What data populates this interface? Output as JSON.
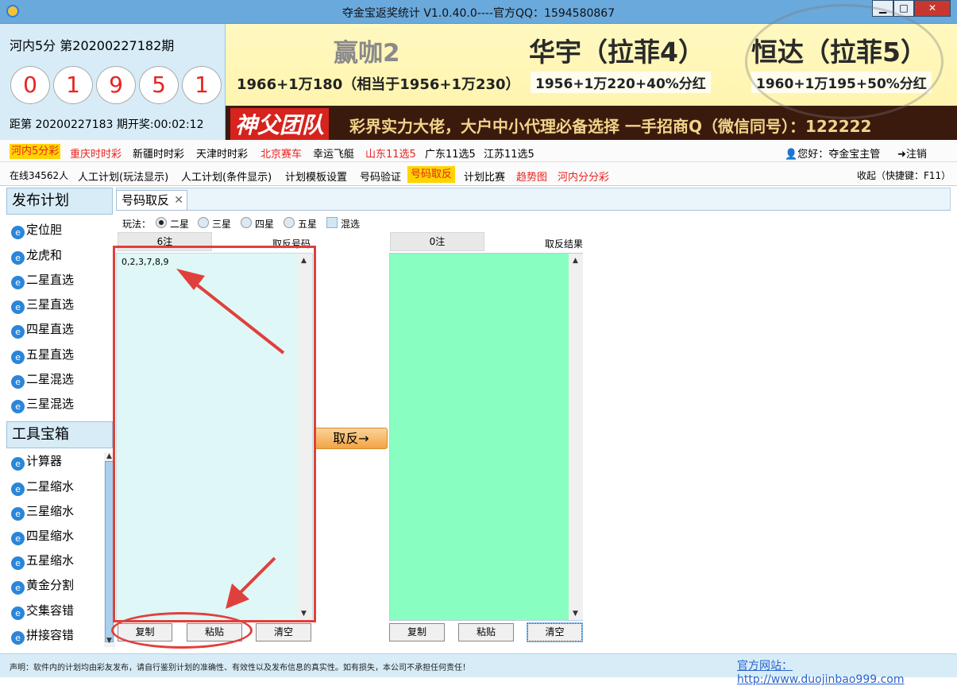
{
  "window": {
    "title": "夺金宝返奖统计  V1.0.40.0----官方QQ：1594580867",
    "min_glyph": "▁",
    "max_glyph": "□",
    "close_glyph": "✕",
    "app_icon": "app-logo-icon"
  },
  "lottery": {
    "name": "河内5分  第20200227182期",
    "balls": [
      "0",
      "1",
      "9",
      "5",
      "1"
    ],
    "next_draw": "距第 20200227183 期开奖:00:02:12"
  },
  "banner": {
    "line1_a": "赢咖2",
    "line1_b": "华宇（拉菲4）",
    "line1_c": "恒达（拉菲5）",
    "line2_a": "1966+1万180（相当于1956+1万230）",
    "line2_b": "1956+1万220+40%分红",
    "line2_c": "1960+1万195+50%分红",
    "team": "神父团队",
    "slogan": "彩界实力大佬，大户中小代理必备选择 一手招商Q（微信同号）：122222"
  },
  "menu1": {
    "items": [
      "河内5分彩",
      "重庆时时彩",
      "新疆时时彩",
      "天津时时彩",
      "北京赛车",
      "幸运飞艇",
      "山东11选5",
      "广东11选5",
      "江苏11选5"
    ],
    "user_greeting": "您好：夺金宝主管",
    "logout": "注销"
  },
  "menu2": {
    "online": "在线34562人",
    "items": [
      "人工计划(玩法显示)",
      "人工计划(条件显示)",
      "计划模板设置",
      "号码验证",
      "号码取反",
      "计划比赛",
      "趋势图",
      "河内分分彩"
    ],
    "collapse": "收起（快捷键：F11）"
  },
  "sidebar": {
    "publish_title": "发布计划",
    "publish_items": [
      "定位胆",
      "龙虎和",
      "二星直选",
      "三星直选",
      "四星直选",
      "五星直选",
      "二星混选",
      "三星混选"
    ],
    "tools_title": "工具宝箱",
    "tools_items": [
      "计算器",
      "二星缩水",
      "三星缩水",
      "四星缩水",
      "五星缩水",
      "黄金分割",
      "交集容错",
      "拼接容错"
    ],
    "scroll_up": "▲",
    "scroll_down": "▼"
  },
  "tab": {
    "label": "号码取反",
    "close": "✕"
  },
  "play": {
    "label": "玩法：",
    "options": [
      "二星",
      "三星",
      "四星",
      "五星"
    ],
    "selected": "二星",
    "mixed": "混选"
  },
  "input_panel": {
    "count": "6注",
    "title": "取反号码",
    "value": "0,2,3,7,8,9",
    "copy": "复制",
    "paste": "粘贴",
    "clear": "清空"
  },
  "invert_button": "取反→",
  "result_panel": {
    "count": "0注",
    "title": "取反结果",
    "copy": "复制",
    "paste": "粘贴",
    "clear": "清空"
  },
  "scroll": {
    "up": "▲",
    "down": "▼"
  },
  "footer": {
    "note": "声明：软件内的计划均由彩友发布，请自行鉴别计划的准确性、有效性以及发布信息的真实性。如有损失，本公司不承担任何责任！",
    "site": "官方网站：http://www.duojinbao999.com"
  },
  "colors": {
    "accent": "#6aa9dc",
    "active_menu": "#ffd400",
    "red_text": "#e8231f",
    "input_bg": "#dff7f7",
    "result_bg": "#88ffc0",
    "annotation": "#e0403c"
  }
}
